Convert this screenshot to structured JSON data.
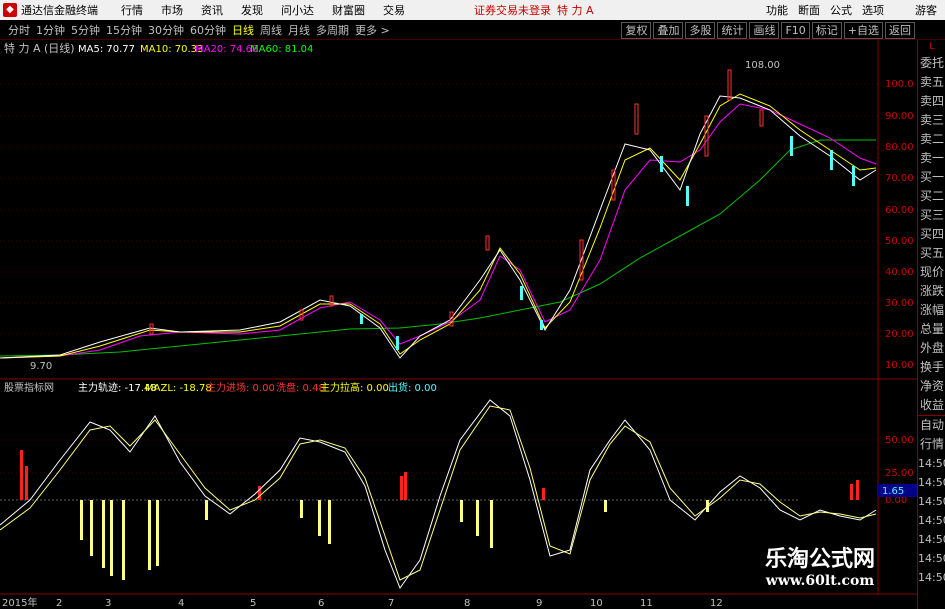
{
  "menubar": {
    "app_name": "通达信金融终端",
    "items": [
      "行情",
      "市场",
      "资讯",
      "发现",
      "问小达",
      "财富圈",
      "交易"
    ],
    "notice": "证券交易未登录",
    "stock_name": "特 力 A",
    "right_items": [
      "功能",
      "断面",
      "公式",
      "选项"
    ],
    "user": "游客"
  },
  "periods": [
    "分时",
    "1分钟",
    "5分钟",
    "15分钟",
    "30分钟",
    "60分钟",
    "日线",
    "周线",
    "月线",
    "多周期",
    "更多 >"
  ],
  "active_period": "日线",
  "toolbar": [
    "复权",
    "叠加",
    "多股",
    "统计",
    "画线",
    "F10",
    "标记",
    "+自选",
    "返回"
  ],
  "legend": {
    "title": "特 力 A (日线)",
    "ma5": "MA5: 70.77",
    "ma10": "MA10: 70.33",
    "ma20": "MA20: 74.68",
    "ma60": "MA60: 81.04"
  },
  "price_axis": [
    "100.0",
    "90.00",
    "80.00",
    "70.00",
    "60.00",
    "50.00",
    "40.00",
    "30.00",
    "20.00",
    "10.00"
  ],
  "annotations": {
    "high": "108.00",
    "low": "9.70"
  },
  "indicator": {
    "title": "股票指标网",
    "track": "主力轨迹: -17.48",
    "mazl": "MAZL: -18.78",
    "enter": "主力进场: 0.00",
    "wash": "洗盘: 0.48",
    "pull": "主力拉高: 0.00",
    "ship": "出货: 0.00",
    "axis": [
      "50.00",
      "25.00",
      "0.00"
    ],
    "current": "1.65"
  },
  "right_panel": [
    "L",
    "委托",
    "卖五",
    "卖四",
    "卖三",
    "卖二",
    "卖一",
    "买一",
    "买二",
    "买三",
    "买四",
    "买五",
    "现价",
    "涨跌",
    "涨幅",
    "总量",
    "外盘",
    "换手",
    "净资",
    "收益",
    "自动",
    "行情",
    "14:50",
    "14:50",
    "14:50",
    "14:50",
    "14:50",
    "14:50",
    "14:50"
  ],
  "time_axis": [
    "2015年",
    "2",
    "3",
    "4",
    "5",
    "6",
    "7",
    "8",
    "9",
    "10",
    "11",
    "12"
  ],
  "watermark": {
    "name": "乐淘公式网",
    "url": "www.60lt.com"
  },
  "colors": {
    "ma5": "#ffffff",
    "ma10": "#ffff00",
    "ma20": "#ff00ff",
    "ma60": "#00ff00",
    "up": "#ff3232",
    "down": "#54fcfc"
  }
}
